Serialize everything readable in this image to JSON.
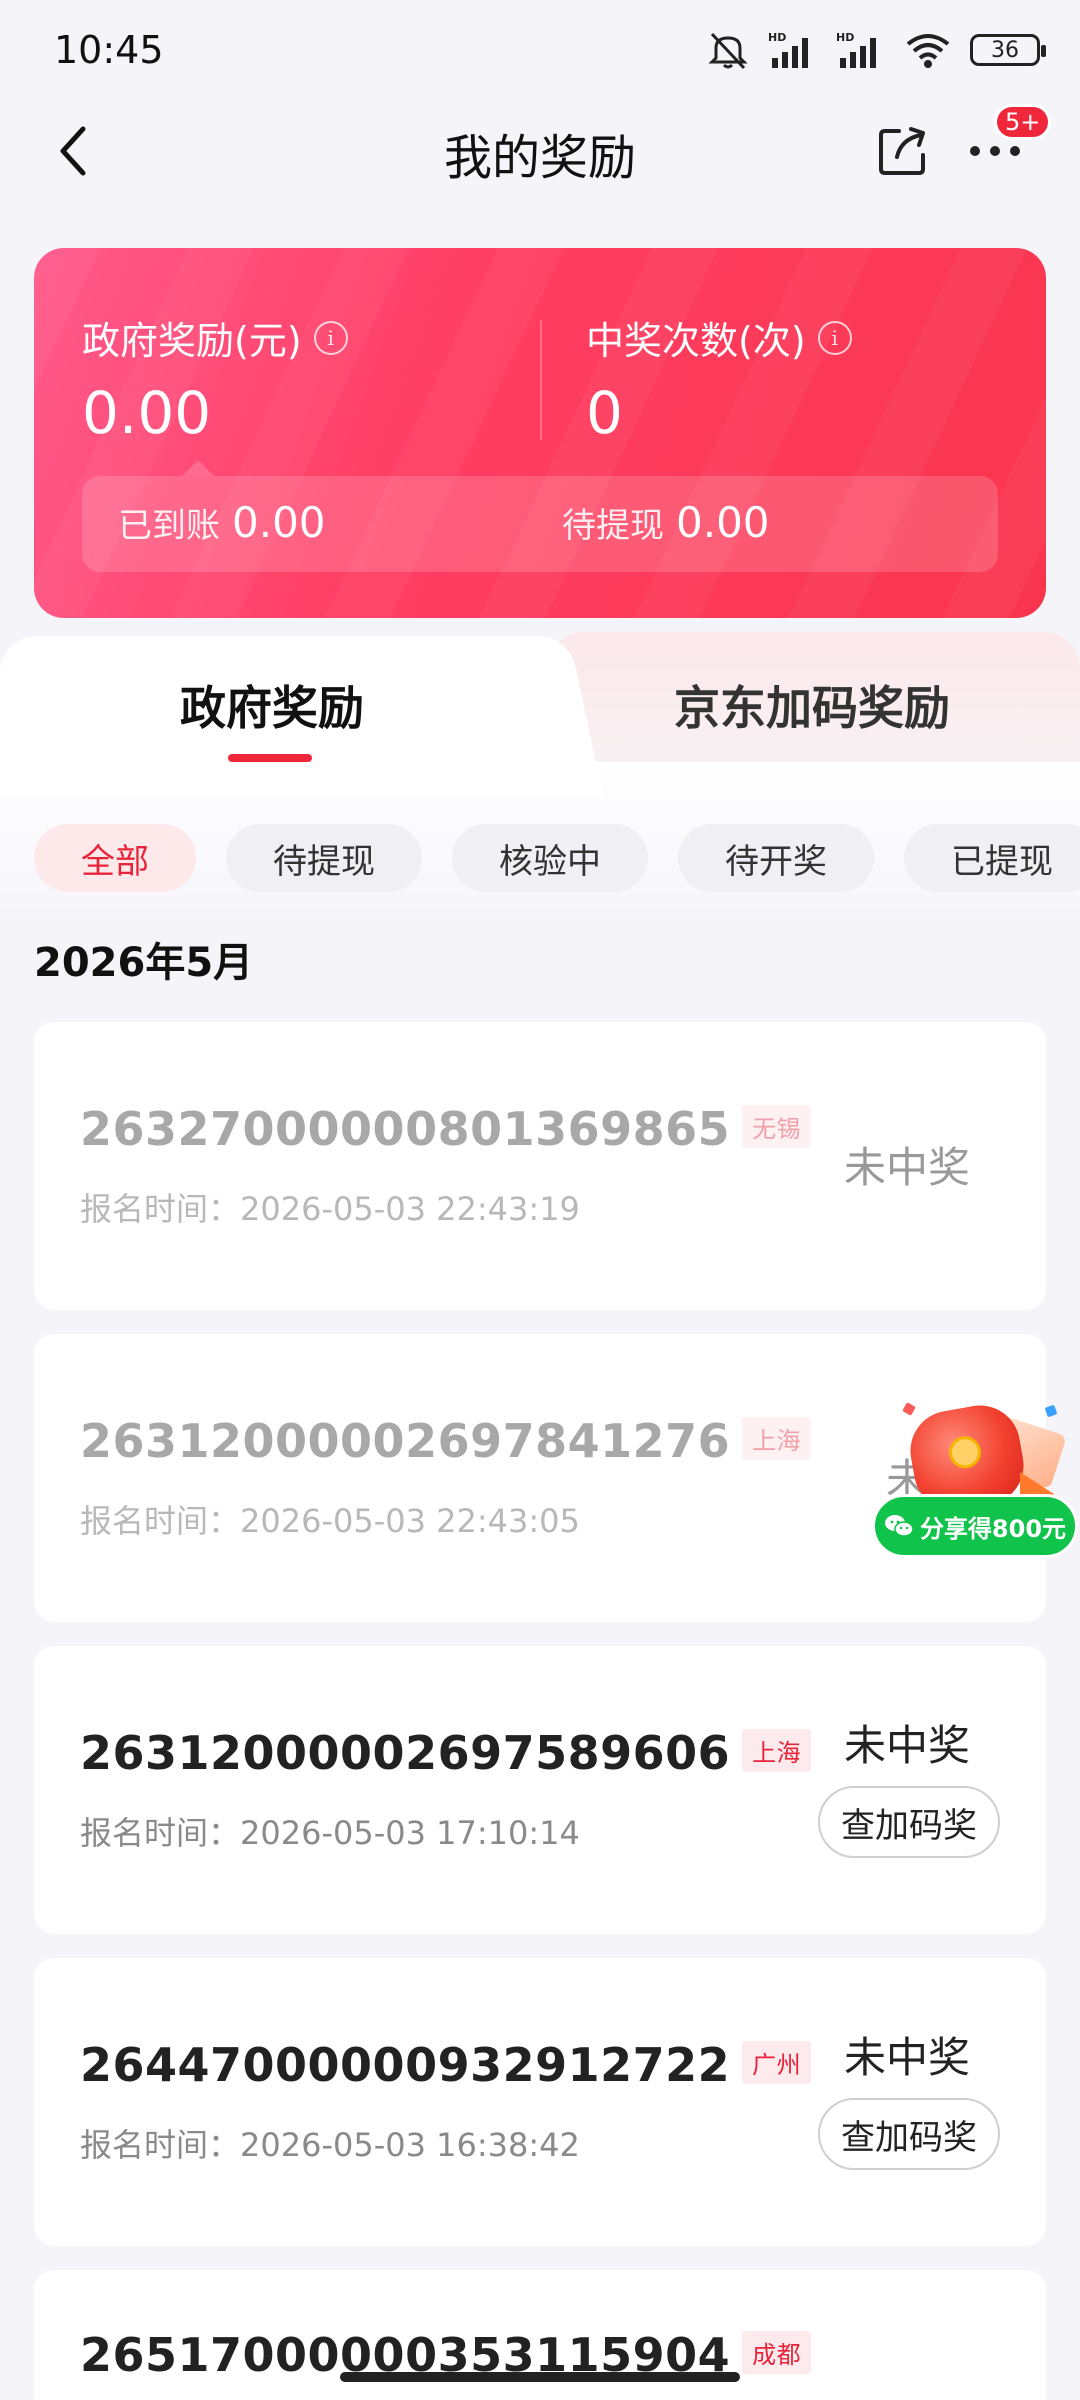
{
  "status_bar": {
    "time": "10:45",
    "battery": "36",
    "icons": [
      "mute-icon",
      "hd-signal-icon",
      "hd-signal-icon",
      "wifi-icon",
      "battery-icon"
    ]
  },
  "header": {
    "title": "我的奖励",
    "badge": "5+",
    "icons": [
      "back-icon",
      "share-icon",
      "more-icon"
    ]
  },
  "summary": {
    "gov_label": "政府奖励(元)",
    "gov_value": "0.00",
    "win_label": "中奖次数(次)",
    "win_value": "0",
    "arrived_label": "已到账",
    "arrived_value": "0.00",
    "pending_label": "待提现",
    "pending_value": "0.00",
    "colors": {
      "gradient_start": "#ff5a8c",
      "gradient_end": "#f9354e"
    }
  },
  "tabs": [
    {
      "label": "政府奖励",
      "active": true
    },
    {
      "label": "京东加码奖励",
      "active": false
    }
  ],
  "filters": [
    {
      "label": "全部",
      "active": true
    },
    {
      "label": "待提现",
      "active": false
    },
    {
      "label": "核验中",
      "active": false
    },
    {
      "label": "待开奖",
      "active": false
    },
    {
      "label": "已提现",
      "active": false
    }
  ],
  "month": "2026年5月",
  "records": [
    {
      "id": "26327000000801369865",
      "city": "无锡",
      "time": "报名时间：2026-05-03 22:43:19",
      "status": "未中奖"
    },
    {
      "id": "26312000002697841276",
      "city": "上海",
      "time": "报名时间：2026-05-03 22:43:05",
      "status": "未中"
    },
    {
      "id": "26312000002697589606",
      "city": "上海",
      "time": "报名时间：2026-05-03 17:10:14",
      "status": "未中奖",
      "action": "查加码奖"
    },
    {
      "id": "26447000000932912722",
      "city": "广州",
      "time": "报名时间：2026-05-03 16:38:42",
      "status": "未中奖",
      "action": "查加码奖"
    },
    {
      "id": "26517000000353115904",
      "city": "成都"
    }
  ],
  "float_share": {
    "label": "分享得800元",
    "icon": "wechat-icon",
    "accent": "#0fc34b"
  },
  "accent_color": "#f0263a"
}
